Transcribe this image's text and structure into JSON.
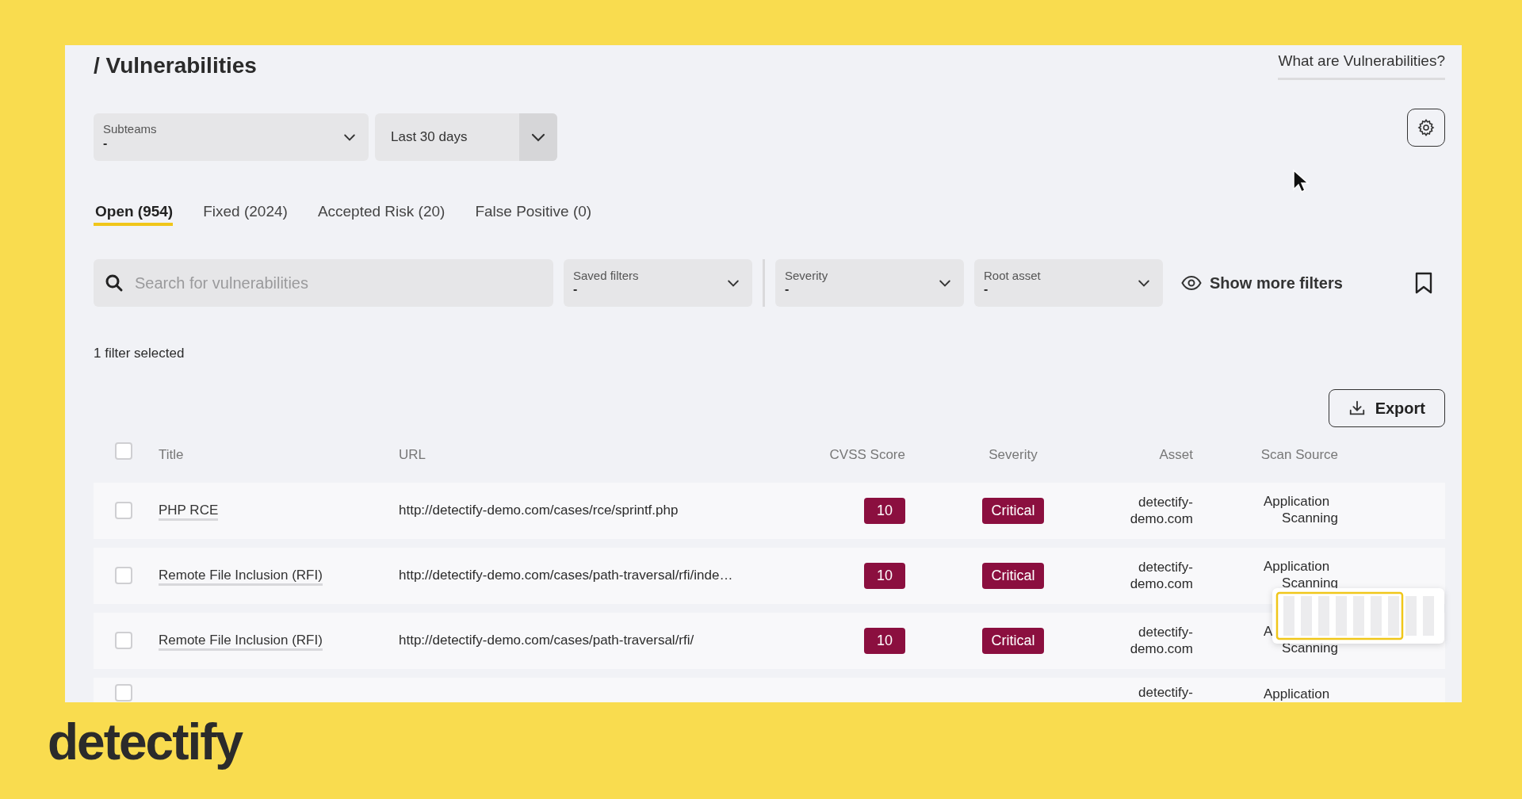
{
  "page": {
    "title": "/ Vulnerabilities",
    "help_link": "What are Vulnerabilities?"
  },
  "top_filters": [
    {
      "kind": "labeled",
      "label": "Subteams",
      "value": "-"
    },
    {
      "kind": "plain",
      "value": "Last 30 days"
    }
  ],
  "tabs": [
    {
      "label": "Open (954)",
      "selected": true
    },
    {
      "label": "Fixed (2024)",
      "selected": false
    },
    {
      "label": "Accepted Risk (20)",
      "selected": false
    },
    {
      "label": "False Positive (0)",
      "selected": false
    }
  ],
  "search": {
    "placeholder": "Search for vulnerabilities"
  },
  "filters": [
    {
      "label": "Saved filters",
      "value": "-"
    },
    {
      "label": "Severity",
      "value": "-"
    },
    {
      "label": "Root asset",
      "value": "-"
    }
  ],
  "show_more": "Show more filters",
  "filter_status": "1 filter selected",
  "export_button": "Export",
  "table": {
    "header_checked": false,
    "columns": [
      "Title",
      "URL",
      "CVSS Score",
      "Severity",
      "Asset",
      "Scan Source"
    ],
    "rows": [
      {
        "checked": false,
        "title": "PHP RCE",
        "url": "http://detectify-demo.com/cases/rce/sprintf.php",
        "cvss": "10",
        "severity": "Critical",
        "asset": "detectify-demo.com",
        "scan_source": [
          "Application",
          "Scanning"
        ]
      },
      {
        "checked": false,
        "title": "Remote File Inclusion (RFI)",
        "url": "http://detectify-demo.com/cases/path-traversal/rfi/inde…",
        "cvss": "10",
        "severity": "Critical",
        "asset": "detectify-demo.com",
        "scan_source": [
          "Application",
          "Scanning"
        ]
      },
      {
        "checked": false,
        "title": "Remote File Inclusion (RFI)",
        "url": "http://detectify-demo.com/cases/path-traversal/rfi/",
        "cvss": "10",
        "severity": "Critical",
        "asset": "detectify-demo.com",
        "scan_source": [
          "A",
          "Scanning"
        ],
        "covered": true
      },
      {
        "checked": false,
        "asset": "detectify-",
        "scan_source": [
          "Application"
        ]
      }
    ]
  },
  "brand": "detectify"
}
